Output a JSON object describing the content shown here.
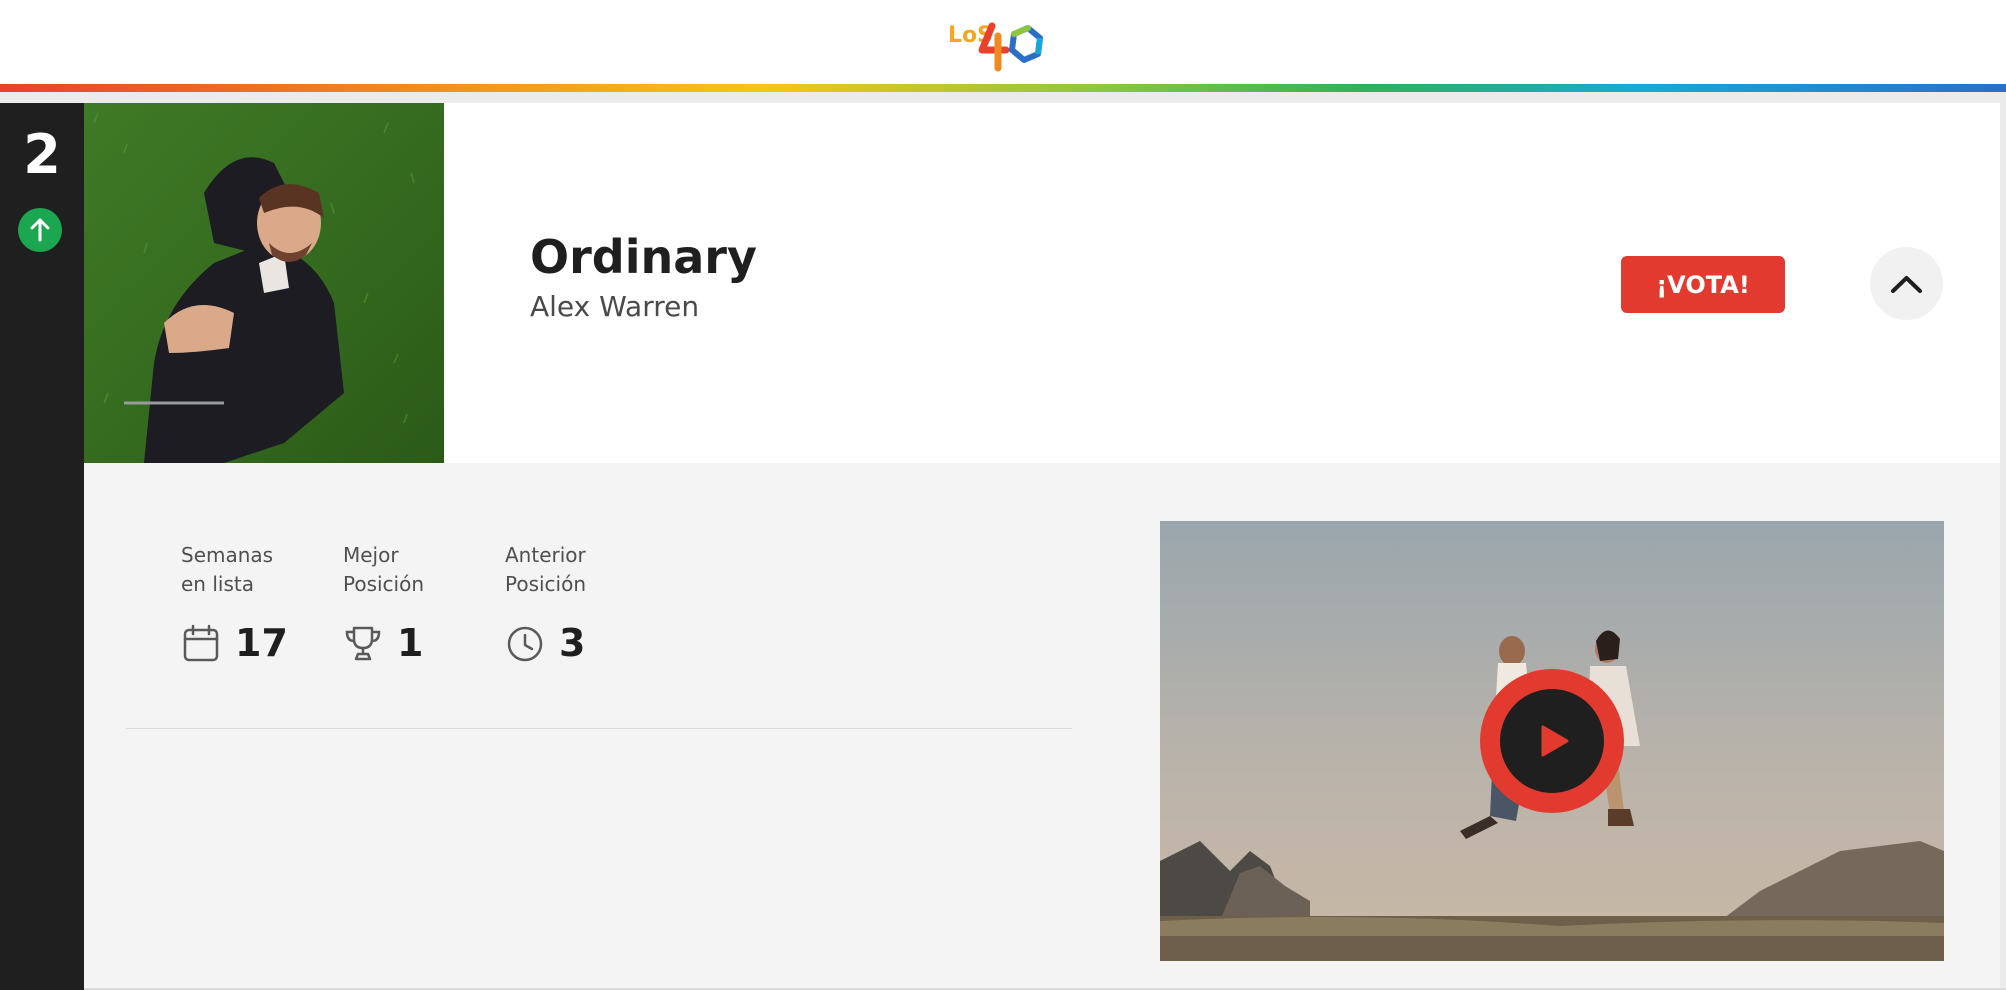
{
  "header": {
    "logo_text": "LOS40",
    "logo_colors": [
      "#f5a623",
      "#e8412c",
      "#8cc63f",
      "#2b6ec8"
    ]
  },
  "entry": {
    "rank": "2",
    "trend": "up",
    "trend_color": "#1ba750",
    "title": "Ordinary",
    "artist": "Alex Warren",
    "vote_label": "¡VOTA!",
    "vote_color": "#e23a2f",
    "collapse_icon": "chevron-up-icon"
  },
  "stats": [
    {
      "label": "Semanas\nen lista",
      "icon": "calendar-icon",
      "value": "17"
    },
    {
      "label": "Mejor\nPosición",
      "icon": "trophy-icon",
      "value": "1"
    },
    {
      "label": "Anterior\nPosición",
      "icon": "clock-icon",
      "value": "3"
    }
  ],
  "video": {
    "play_icon": "play-icon",
    "play_ring_color": "#e23a2f"
  }
}
